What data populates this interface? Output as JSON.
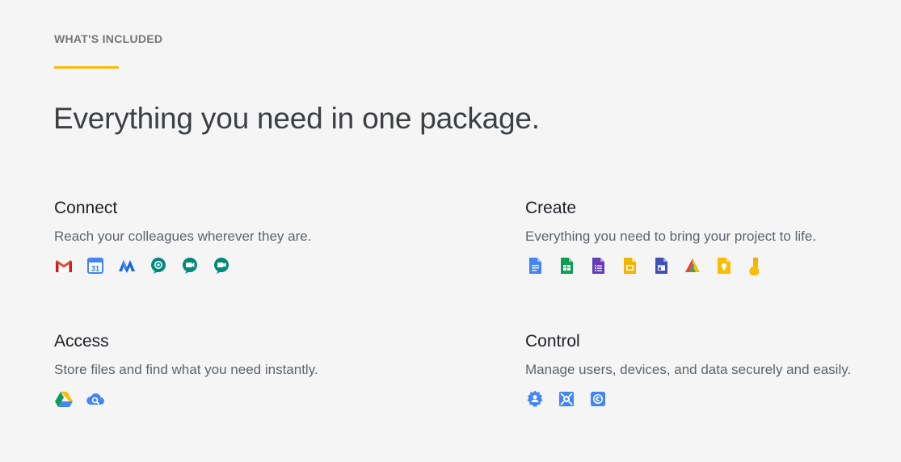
{
  "section": {
    "eyebrow": "WHAT'S INCLUDED",
    "accent_color": "#fbbc04",
    "headline": "Everything you need in one package."
  },
  "features": {
    "connect": {
      "title": "Connect",
      "description": "Reach your colleagues wherever they are.",
      "icons": [
        "gmail-icon",
        "calendar-icon",
        "currents-icon",
        "chat-icon",
        "meet-icon",
        "meet-icon"
      ],
      "calendar_day": "31"
    },
    "create": {
      "title": "Create",
      "description": "Everything you need to bring your project to life.",
      "icons": [
        "docs-icon",
        "sheets-icon",
        "forms-icon",
        "slides-icon",
        "sites-icon",
        "appsheet-icon",
        "keep-icon",
        "jamboard-icon"
      ]
    },
    "access": {
      "title": "Access",
      "description": "Store files and find what you need instantly.",
      "icons": [
        "drive-icon",
        "cloud-search-icon"
      ]
    },
    "control": {
      "title": "Control",
      "description": "Manage users, devices, and data securely and easily.",
      "icons": [
        "admin-icon",
        "vault-icon",
        "endpoint-icon"
      ]
    }
  }
}
